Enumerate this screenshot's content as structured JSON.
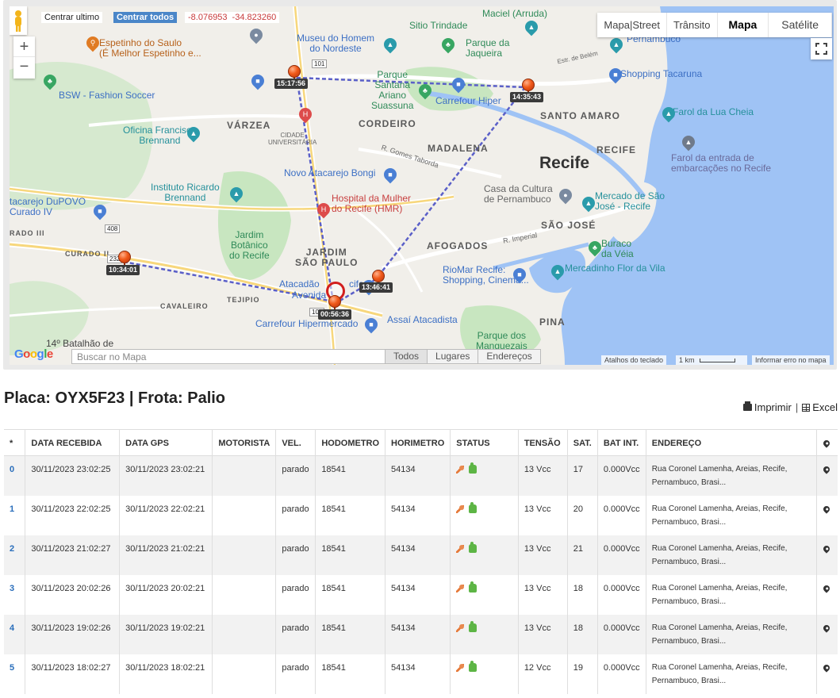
{
  "map": {
    "center_last_label": "Centrar ultimo",
    "center_all_label": "Centrar todos",
    "lat": "-8.076953",
    "lng": "-34.823260",
    "zoom_in": "+",
    "zoom_out": "−",
    "map_types": [
      "Mapa|Street",
      "Trânsito",
      "Mapa",
      "Satélite"
    ],
    "search_placeholder": "Buscar no Mapa",
    "tabs": [
      "Todos",
      "Lugares",
      "Endereços"
    ],
    "google": "Google",
    "attribution": {
      "keys": "Atalhos do teclado",
      "scale": "1 km",
      "report": "Informar erro no mapa"
    },
    "markers": [
      "15:17:56",
      "14:35:43",
      "10:34:01",
      "13:46:41",
      "00:56:36"
    ],
    "labels": {
      "espetinho": "Espetinho do Saulo\n(É Melhor Espetinho e...",
      "museu": "Museu do Homem\ndo Nordeste",
      "sitio": "Sitio Trindade",
      "parque_jaqueira": "Parque da\nJaqueira",
      "maciel": "Maciel (Arruda)",
      "ce_pernambuco": "Ce\nPernambuco",
      "bsw": "BSW - Fashion Soccer",
      "parque_santana": "Parque\nSantana\nAriano\nSuassuna",
      "carrefour_hiper": "Carrefour Hiper",
      "shopping_tacaruna": "Shopping Tacaruna",
      "varzea": "VÁRZEA",
      "cordeiro": "CORDEIRO",
      "santo_amaro": "SANTO AMARO",
      "oficina": "Oficina Francisco\nBrennand",
      "cidade_univ": "CIDADE\nUNIVERSITÁRIA",
      "madalena": "MADALENA",
      "farol": "Farol da Lua Cheia",
      "farol_entrada": "Farol da entrada de\nembarcações no Recife",
      "recife_bairro": "RECIFE",
      "recife": "Recife",
      "gomes_taborda": "R. Gomes Taborda",
      "novo_atacarejo": "Novo Atacarejo Bongi",
      "instituto": "Instituto Ricardo\nBrennand",
      "casa_cultura": "Casa da Cultura\nde Pernambuco",
      "mercado_sao_jose": "Mercado de São\nJosé - Recife",
      "hospital": "Hospital da Mulher\ndo Recife (HMR)",
      "atacarejo_dupovo": "tacarejo DuPOVO\nCurado IV",
      "sao_jose": "SÃO JOSÉ",
      "r_imperial": "R. Imperial",
      "jardim_botanico": "Jardim\nBotânico\ndo Recife",
      "afogados": "AFOGADOS",
      "buraco_veia": "Buraco\nda Véia",
      "jardim_sao_paulo": "JARDIM\nSÃO PAULO",
      "curado_iii": "RADO III",
      "curado_ii": "CURADO II",
      "riomar": "RioMar Recife:\nShopping, Cinema...",
      "mercadinho": "Mercadinho Flor da Vila",
      "atacadao": "Atacadão",
      "avenida": "Avenida",
      "tejipio": "TEJIPIO",
      "cavaleiro": "CAVALEIRO",
      "carrefour_hipermercado": "Carrefour Hipermercado",
      "assai": "Assaí Atacadista",
      "pina": "PINA",
      "parque_manguezais": "Parque dos\nManguezais",
      "batalhao": "14º Batalhão de",
      "r408": "408",
      "r101": "101",
      "r232": "232",
      "r101b": "101",
      "r_belem": "Estr. de Belém",
      "cifre": "cife"
    }
  },
  "header": {
    "title": "Placa: OYX5F23 | Frota: Palio",
    "print_label": "Imprimir",
    "sep": "|",
    "excel_label": "Excel"
  },
  "table": {
    "columns": [
      "*",
      "DATA RECEBIDA",
      "DATA GPS",
      "MOTORISTA",
      "VEL.",
      "HODOMETRO",
      "HORIMETRO",
      "STATUS",
      "TENSÃO",
      "SAT.",
      "BAT INT.",
      "ENDEREÇO",
      ""
    ],
    "rows": [
      {
        "idx": "0",
        "recebida": "30/11/2023 23:02:25",
        "gps": "30/11/2023 23:02:21",
        "motorista": "",
        "vel": "parado",
        "hodometro": "18541",
        "horimetro": "54134",
        "tensao": "13 Vcc",
        "sat": "17",
        "bat": "0.000Vcc",
        "endereco1": "Rua Coronel Lamenha, Areias, Recife,",
        "endereco2": "Pernambuco, Brasi..."
      },
      {
        "idx": "1",
        "recebida": "30/11/2023 22:02:25",
        "gps": "30/11/2023 22:02:21",
        "motorista": "",
        "vel": "parado",
        "hodometro": "18541",
        "horimetro": "54134",
        "tensao": "13 Vcc",
        "sat": "20",
        "bat": "0.000Vcc",
        "endereco1": "Rua Coronel Lamenha, Areias, Recife,",
        "endereco2": "Pernambuco, Brasi..."
      },
      {
        "idx": "2",
        "recebida": "30/11/2023 21:02:27",
        "gps": "30/11/2023 21:02:21",
        "motorista": "",
        "vel": "parado",
        "hodometro": "18541",
        "horimetro": "54134",
        "tensao": "13 Vcc",
        "sat": "21",
        "bat": "0.000Vcc",
        "endereco1": "Rua Coronel Lamenha, Areias, Recife,",
        "endereco2": "Pernambuco, Brasi..."
      },
      {
        "idx": "3",
        "recebida": "30/11/2023 20:02:26",
        "gps": "30/11/2023 20:02:21",
        "motorista": "",
        "vel": "parado",
        "hodometro": "18541",
        "horimetro": "54134",
        "tensao": "13 Vcc",
        "sat": "18",
        "bat": "0.000Vcc",
        "endereco1": "Rua Coronel Lamenha, Areias, Recife,",
        "endereco2": "Pernambuco, Brasi..."
      },
      {
        "idx": "4",
        "recebida": "30/11/2023 19:02:26",
        "gps": "30/11/2023 19:02:21",
        "motorista": "",
        "vel": "parado",
        "hodometro": "18541",
        "horimetro": "54134",
        "tensao": "13 Vcc",
        "sat": "18",
        "bat": "0.000Vcc",
        "endereco1": "Rua Coronel Lamenha, Areias, Recife,",
        "endereco2": "Pernambuco, Brasi..."
      },
      {
        "idx": "5",
        "recebida": "30/11/2023 18:02:27",
        "gps": "30/11/2023 18:02:21",
        "motorista": "",
        "vel": "parado",
        "hodometro": "18541",
        "horimetro": "54134",
        "tensao": "12 Vcc",
        "sat": "19",
        "bat": "0.000Vcc",
        "endereco1": "Rua Coronel Lamenha, Areias, Recife,",
        "endereco2": "Pernambuco, Brasi..."
      }
    ]
  },
  "colors": {
    "accent": "#2a6ebb",
    "route": "#5a5fc8",
    "marker": "#f05a1a",
    "water": "#9fc3f5",
    "park": "#c8e6c0"
  },
  "icons": {
    "pegman": "pegman-icon",
    "fullscreen": "fullscreen-icon",
    "print": "print-icon",
    "excel": "excel-icon",
    "status_key": "key-icon",
    "status_ok": "thumbs-up-icon",
    "location": "map-pin-icon"
  }
}
